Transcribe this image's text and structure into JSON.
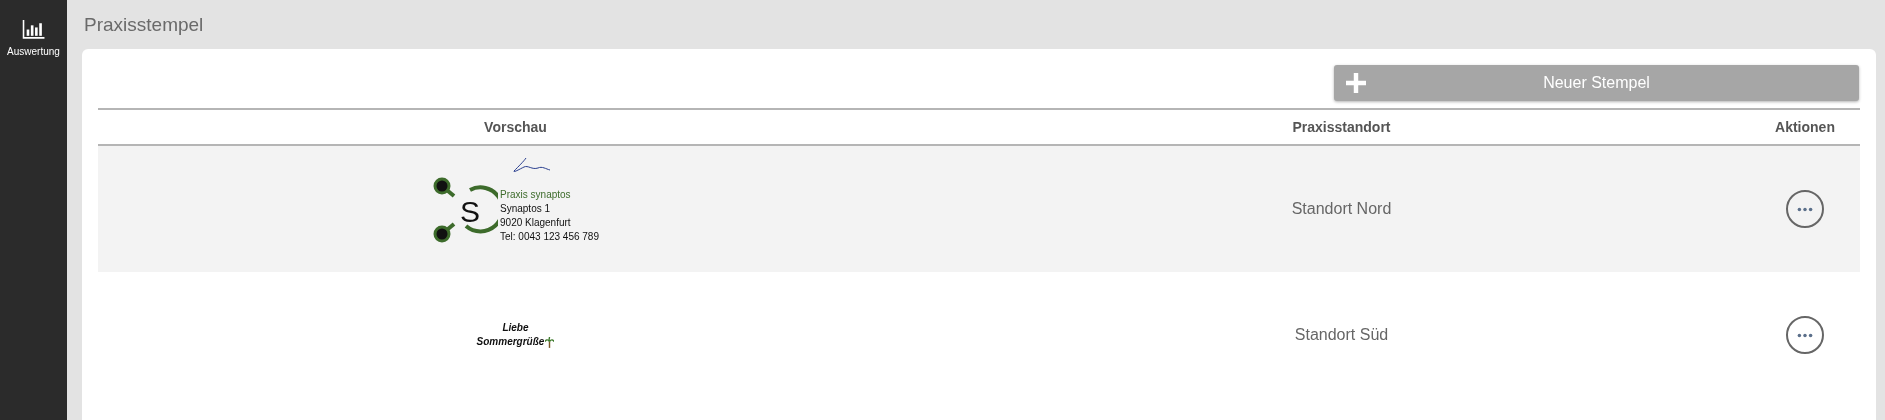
{
  "sidebar": {
    "items": [
      {
        "label": "Auswertung",
        "selected": false
      }
    ]
  },
  "page_title": "Praxisstempel",
  "new_button": {
    "label": "Neuer Stempel"
  },
  "table": {
    "columns": [
      "Vorschau",
      "Praxisstandort",
      "Aktionen"
    ],
    "rows": [
      {
        "selected": true,
        "stamp": {
          "kind": "logo",
          "lines": [
            "Praxis synaptos",
            "Synaptos 1",
            "9020 Klagenfurt",
            "Tel: 0043 123 456 789"
          ],
          "logo_letter": "S"
        },
        "location": "Standort Nord"
      },
      {
        "selected": false,
        "stamp": {
          "kind": "greeting",
          "lines": [
            "Liebe",
            "Sommergrüße"
          ]
        },
        "location": "Standort Süd"
      }
    ]
  }
}
